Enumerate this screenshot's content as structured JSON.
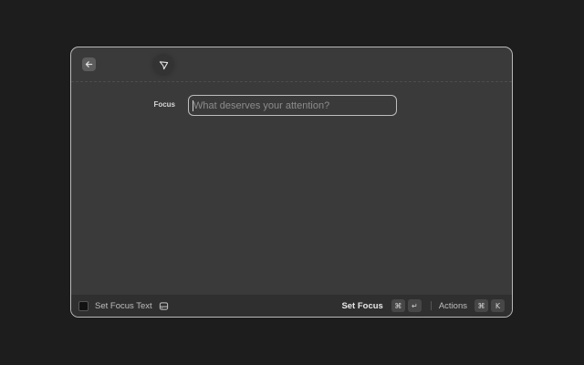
{
  "form": {
    "field_label": "Focus",
    "input_placeholder": "What deserves your attention?",
    "input_value": ""
  },
  "footer": {
    "title": "Set Focus Text",
    "primary_action": "Set Focus",
    "primary_shortcut": [
      "⌘",
      "↵"
    ],
    "actions_label": "Actions",
    "actions_shortcut": [
      "⌘",
      "K"
    ]
  },
  "colors": {
    "background": "#1d1d1d",
    "window": "#3a3a3a",
    "footer": "#2f2f2f",
    "border": "#b9b9b9"
  },
  "icons": {
    "back": "arrow-left-icon",
    "extension": "focus-icon",
    "app": "app-icon",
    "status": "hard-drive-icon"
  }
}
